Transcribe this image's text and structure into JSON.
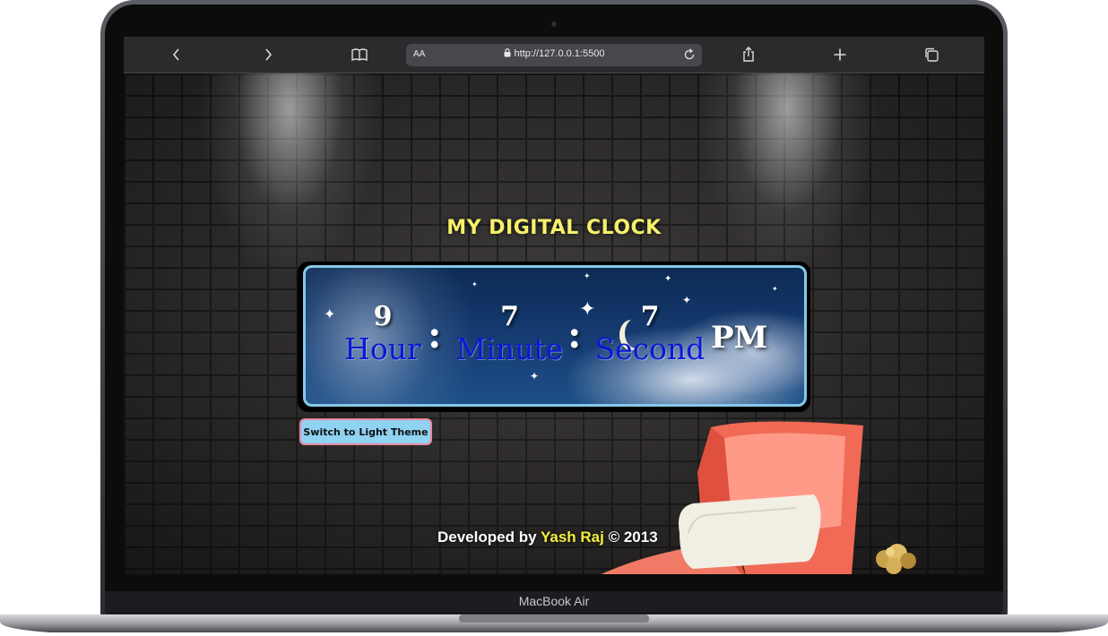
{
  "browser": {
    "text_size_label": "AA",
    "url": "http://127.0.0.1:5500",
    "icons": [
      "back-icon",
      "forward-icon",
      "bookmarks-icon",
      "lock-icon",
      "reload-icon",
      "share-icon",
      "new-tab-icon",
      "tabs-icon"
    ]
  },
  "page": {
    "title": "MY DIGITAL CLOCK",
    "clock": {
      "hour_value": "9",
      "hour_label": "Hour",
      "minute_value": "7",
      "minute_label": "Minute",
      "second_value": "7",
      "second_label": "Second",
      "separator": ":",
      "ampm": "PM"
    },
    "theme_button": "Switch to Light Theme",
    "credit": {
      "prefix": "Developed by",
      "name": "Yash Raj",
      "suffix": "© 2013"
    },
    "colors": {
      "title": "#f7f06a",
      "label": "#0a18d6",
      "button_bg": "#8fd2f2",
      "button_border": "#e98aa0",
      "credit_name": "#f2f03a"
    }
  },
  "device": {
    "label": "MacBook Air"
  }
}
